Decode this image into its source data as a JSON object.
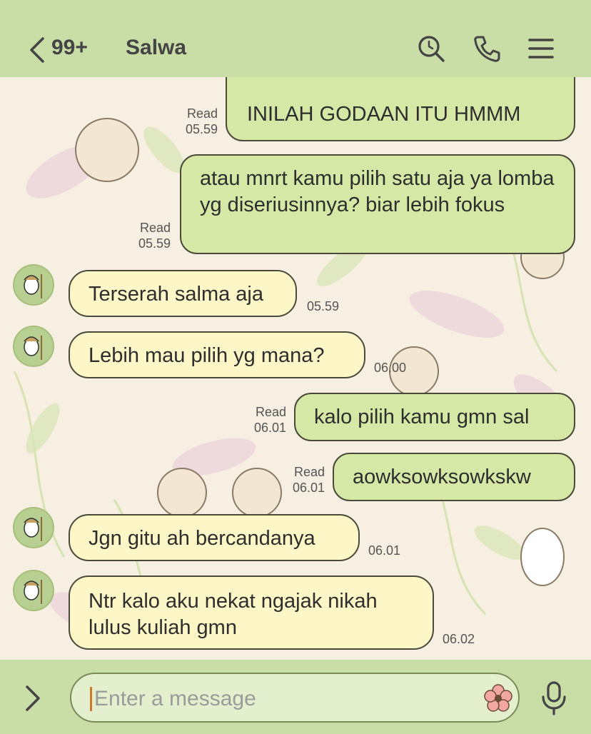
{
  "header": {
    "unread_count": "99+",
    "contact_name": "Salwa"
  },
  "messages": [
    {
      "direction": "out",
      "text": "INILAH GODAAN ITU HMMM",
      "status": "Read",
      "time": "05.59"
    },
    {
      "direction": "out",
      "text": "atau mnrt kamu pilih satu aja ya lomba yg diseriusinnya? biar lebih fokus",
      "status": "Read",
      "time": "05.59"
    },
    {
      "direction": "in",
      "text": "Terserah salma aja",
      "time": "05.59"
    },
    {
      "direction": "in",
      "text": "Lebih mau pilih yg mana?",
      "time": "06.00"
    },
    {
      "direction": "out",
      "text": "kalo pilih kamu gmn sal",
      "status": "Read",
      "time": "06.01"
    },
    {
      "direction": "out",
      "text": "aowksowksowkskw",
      "status": "Read",
      "time": "06.01"
    },
    {
      "direction": "in",
      "text": "Jgn gitu ah bercandanya",
      "time": "06.01"
    },
    {
      "direction": "in",
      "text": "Ntr kalo aku nekat ngajak nikah lulus kuliah gmn",
      "time": "06.02"
    }
  ],
  "composer": {
    "placeholder": "Enter a message"
  },
  "icons": {
    "back": "chevron-left-icon",
    "search": "search-icon",
    "call": "phone-icon",
    "menu": "menu-icon",
    "expand": "chevron-right-icon",
    "emoji": "flower-sticker-icon",
    "mic": "microphone-icon"
  },
  "colors": {
    "header_bg": "#c9dda6",
    "outgoing_bubble": "#d6e8a6",
    "incoming_bubble": "#fdf6c6",
    "chat_bg": "#f6efe2"
  }
}
